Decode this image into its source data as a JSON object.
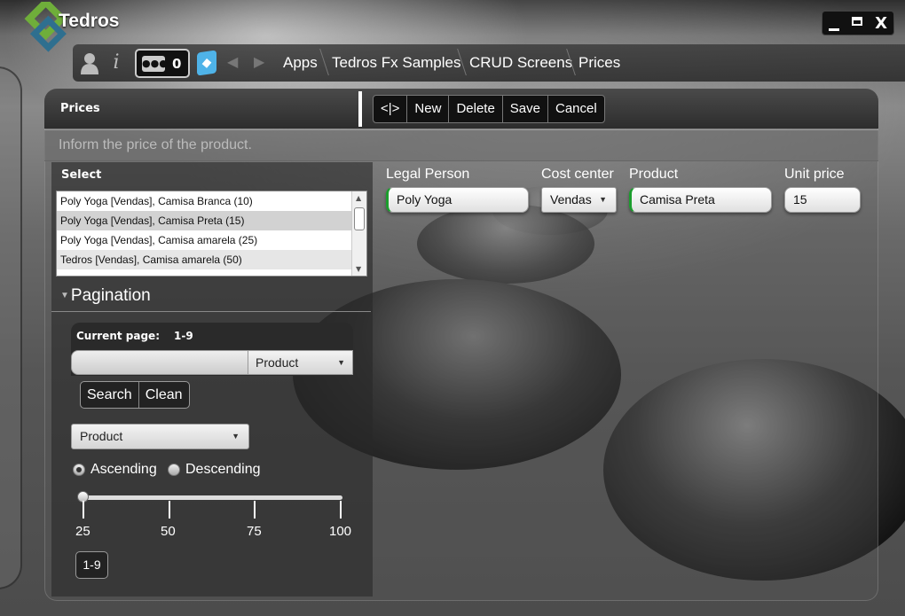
{
  "app": {
    "title": "Tedros",
    "window_min": "_",
    "window_close": "X"
  },
  "navbar": {
    "notifications_count": "0",
    "breadcrumbs": [
      "Apps",
      "Tedros Fx Samples",
      "CRUD Screens",
      "Prices"
    ]
  },
  "header": {
    "title": "Prices"
  },
  "toolbar": {
    "toggle": "<|>",
    "new": "New",
    "delete": "Delete",
    "save": "Save",
    "cancel": "Cancel"
  },
  "description": "Inform the price of the product.",
  "select": {
    "label": "Select",
    "items": [
      "Poly Yoga [Vendas], Camisa Branca (10)",
      "Poly Yoga [Vendas], Camisa Preta (15)",
      "Poly Yoga [Vendas], Camisa amarela (25)",
      "Tedros [Vendas], Camisa amarela (50)"
    ],
    "selected_index": 1
  },
  "pagination": {
    "title": "Pagination",
    "current_page_label": "Current page:",
    "current_page_value": "1-9",
    "search_value": "",
    "search_field": "Product",
    "search_button": "Search",
    "clean_button": "Clean",
    "order_by": "Product",
    "ascending": "Ascending",
    "descending": "Descending",
    "sort": "Ascending",
    "page_size_ticks": [
      "25",
      "50",
      "75",
      "100"
    ],
    "page_size_value": 25,
    "page_button": "1-9"
  },
  "form": {
    "legal_person": {
      "label": "Legal Person",
      "value": "Poly Yoga"
    },
    "cost_center": {
      "label": "Cost center",
      "value": "Vendas"
    },
    "product": {
      "label": "Product",
      "value": "Camisa Preta"
    },
    "unit_price": {
      "label": "Unit price",
      "value": "15"
    }
  },
  "colors": {
    "required_accent": "#1b9e2d",
    "tedros_icon": "#4fb3e8",
    "logo_green": "#6fae3a",
    "logo_blue": "#2f6f8f"
  },
  "icons": [
    "logo-icon",
    "user-icon",
    "info-icon",
    "people-icon",
    "tedros-icon",
    "back-arrow-icon",
    "forward-arrow-icon",
    "chevron-down-icon"
  ]
}
